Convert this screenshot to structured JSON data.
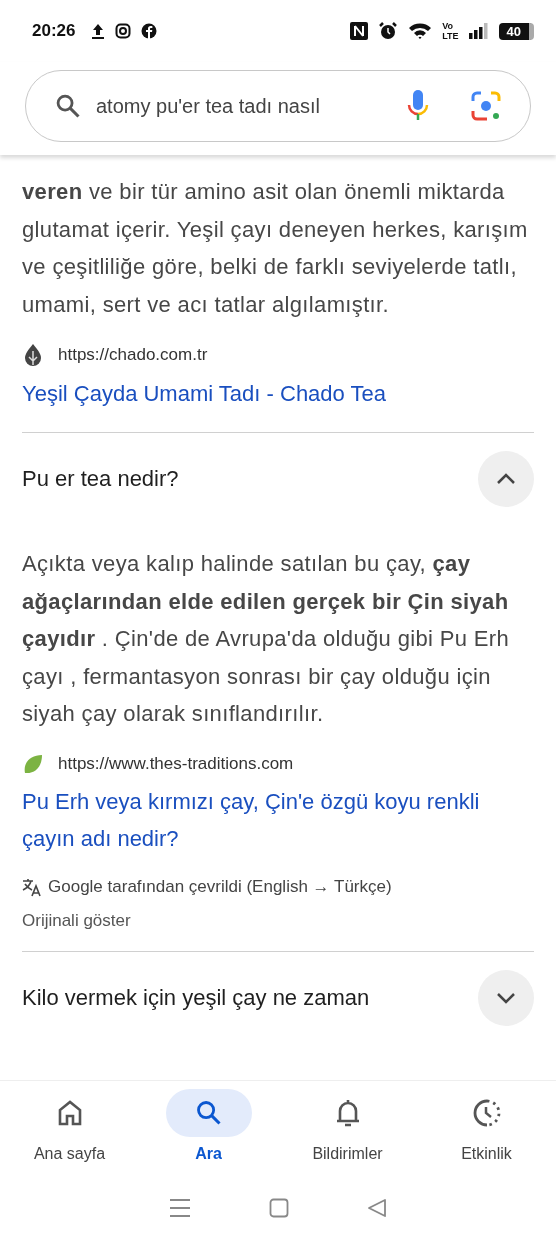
{
  "status_bar": {
    "time": "20:26",
    "network_top": "Vo",
    "network_bottom": "LTE",
    "battery": "40"
  },
  "search": {
    "value": "atomy pu'er tea tadı nasıl"
  },
  "answers": [
    {
      "kind": "snippet",
      "paragraph": "**veren** ve bir tür amino asit olan önemli miktarda glutamat içerir. Yeşil çayı deneyen herkes, karışım ve çeşitliliğe göre, belki de farklı seviyelerde tatlı, umami, sert ve acı tatlar algılamıştır.",
      "source_url": "https://chado.com.tr",
      "source_title": "Yeşil Çayda Umami Tadı - Chado Tea"
    },
    {
      "kind": "question",
      "question": "Pu er tea nedir?",
      "expanded": true,
      "paragraph": "Açıkta veya kalıp halinde satılan bu çay, **çay ağaçlarından elde edilen gerçek bir Çin siyah çayıdır** . Çin'de de Avrupa'da olduğu gibi Pu Erh çayı , fermantasyon sonrası bir çay olduğu için siyah çay olarak sınıflandırılır.",
      "source_url": "https://www.thes-traditions.com",
      "source_title": "Pu Erh veya kırmızı çay, Çin'e özgü koyu renkli çayın adı nedir?",
      "translation_note": "Google tarafından çevrildi (English → Türkçe)",
      "show_original": "Orijinali göster"
    },
    {
      "kind": "question",
      "question": "Kilo vermek için yeşil çay ne zaman",
      "expanded": false
    }
  ],
  "bottom_nav": [
    {
      "label": "Ana sayfa",
      "selected": false
    },
    {
      "label": "Ara",
      "selected": true
    },
    {
      "label": "Bildirimler",
      "selected": false
    },
    {
      "label": "Etkinlik",
      "selected": false
    }
  ]
}
